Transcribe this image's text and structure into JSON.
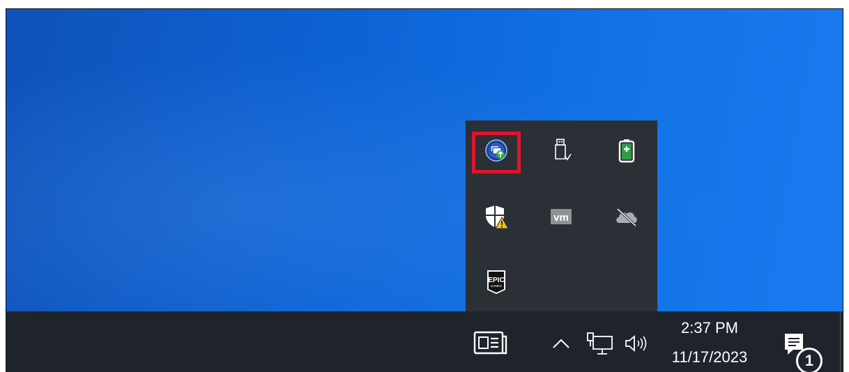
{
  "desktop": {
    "background_color": "#0d63d6"
  },
  "tray_overflow": {
    "highlight_color": "#e2122a",
    "icons": [
      {
        "name": "network-sharing-icon",
        "highlighted": true
      },
      {
        "name": "usb-eject-icon",
        "highlighted": false
      },
      {
        "name": "battery-icon",
        "highlighted": false
      },
      {
        "name": "windows-security-warning-icon",
        "highlighted": false
      },
      {
        "name": "vmware-icon",
        "highlighted": false
      },
      {
        "name": "onedrive-offline-icon",
        "highlighted": false
      },
      {
        "name": "epic-games-icon",
        "highlighted": false
      }
    ],
    "vm_label": "vm",
    "epic_label": "EPIC",
    "epic_sublabel": "GAMES"
  },
  "taskbar": {
    "background_color": "#1f242c",
    "clock": {
      "time": "2:37 PM",
      "date": "11/17/2023"
    },
    "notifications": {
      "count": "1"
    }
  }
}
